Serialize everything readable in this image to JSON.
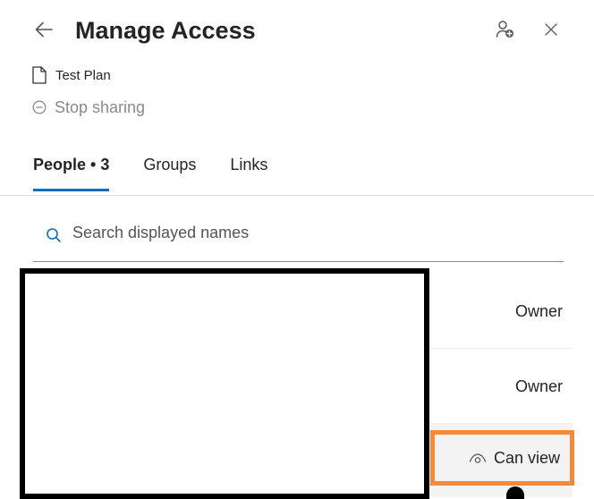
{
  "header": {
    "title": "Manage Access",
    "icons": {
      "back": "arrow-left-icon",
      "add_person": "person-add-icon",
      "close": "close-icon"
    }
  },
  "file": {
    "name": "Test Plan",
    "icon": "document-icon"
  },
  "stop_sharing": {
    "label": "Stop sharing",
    "icon": "minus-circle-icon"
  },
  "tabs": [
    {
      "label": "People • 3",
      "active": true
    },
    {
      "label": "Groups",
      "active": false
    },
    {
      "label": "Links",
      "active": false
    }
  ],
  "search": {
    "placeholder": "Search displayed names",
    "value": "",
    "icon": "search-icon"
  },
  "people": [
    {
      "role": "Owner"
    },
    {
      "role": "Owner"
    },
    {
      "role": "Can view",
      "icon": "eye-icon"
    }
  ],
  "colors": {
    "accent": "#0f6cbd",
    "highlight": "#f28a3a",
    "muted_text": "#8a8a8a"
  }
}
